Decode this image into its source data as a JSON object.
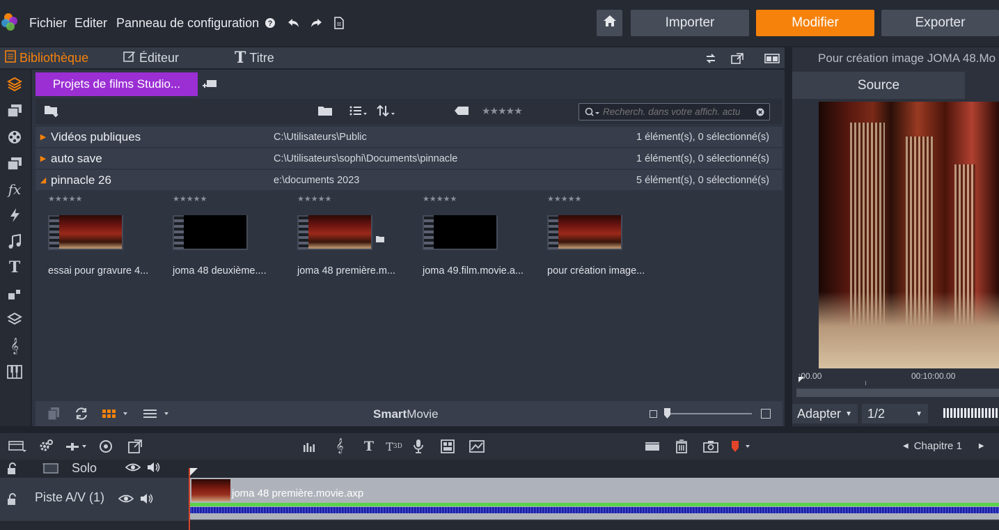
{
  "menubar": {
    "items": [
      "Fichier",
      "Editer",
      "Panneau de configuration"
    ],
    "icons": [
      "help-icon",
      "undo-icon",
      "redo-icon",
      "document-icon"
    ],
    "home_icon": "home-icon",
    "modes": [
      "Importer",
      "Modifier",
      "Exporter"
    ],
    "active_mode": "Modifier",
    "accent": "#f6820c"
  },
  "library": {
    "tabs": [
      "Bibliothèque",
      "Éditeur",
      "Titre"
    ],
    "project_tab": "Projets de films Studio...",
    "search_placeholder": "Recherch. dans votre affich. actu",
    "folders": [
      {
        "name": "Vidéos publiques",
        "path": "C:\\Utilisateurs\\Public",
        "count": "1 élément(s), 0 sélectionné(s)",
        "expanded": false
      },
      {
        "name": "auto save",
        "path": "C:\\Utilisateurs\\sophi\\Documents\\pinnacle",
        "count": "1 élément(s), 0 sélectionné(s)",
        "expanded": false
      },
      {
        "name": "pinnacle 26",
        "path": "e:\\documents 2023",
        "count": "5 élément(s), 0 sélectionné(s)",
        "expanded": true
      }
    ],
    "clips": [
      {
        "label": "essai pour gravure 4...",
        "thumb": "scene"
      },
      {
        "label": "joma 48 deuxième....",
        "thumb": "black"
      },
      {
        "label": "joma 48 première.m...",
        "thumb": "scene"
      },
      {
        "label": "joma 49.film.movie.a...",
        "thumb": "black"
      },
      {
        "label": "pour création image...",
        "thumb": "scene"
      }
    ],
    "smartmovie": {
      "bold": "Smart",
      "rest": "Movie"
    }
  },
  "preview": {
    "title": "Pour création image JOMA 48.Mo",
    "source_tab": "Source",
    "time_start": ":00.00",
    "time_mid": "00:10:00.00",
    "fit_select": "Adapter",
    "res_select": "1/2"
  },
  "timeline": {
    "chapter": "Chapitre 1",
    "solo_label": "Solo",
    "track_label": "Piste A/V (1)",
    "clip_name": "joma 48 première.movie.axp"
  }
}
